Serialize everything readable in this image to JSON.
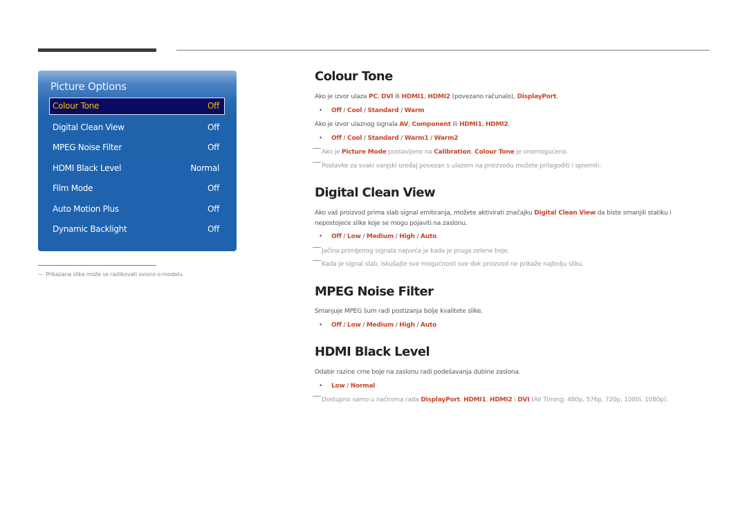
{
  "menu": {
    "title": "Picture Options",
    "items": [
      {
        "label": "Colour Tone",
        "value": "Off",
        "selected": true
      },
      {
        "label": "Digital Clean View",
        "value": "Off"
      },
      {
        "label": "MPEG Noise Filter",
        "value": "Off"
      },
      {
        "label": "HDMI Black Level",
        "value": "Normal"
      },
      {
        "label": "Film Mode",
        "value": "Off"
      },
      {
        "label": "Auto Motion Plus",
        "value": "Off"
      },
      {
        "label": "Dynamic Backlight",
        "value": "Off"
      }
    ]
  },
  "footnote": "Prikazana slika može se razlikovati ovisno o modelu.",
  "footnote_dash": "−",
  "sections": {
    "colour_tone": {
      "title": "Colour Tone",
      "p1": [
        "Ako je izvor ulaza ",
        "PC",
        ", ",
        "DVI",
        " ili ",
        "HDMI1",
        ", ",
        "HDMI2",
        " (povezano računalo), ",
        "DisplayPort",
        "."
      ],
      "opts1": [
        "Off",
        "Cool",
        "Standard",
        "Warm"
      ],
      "p2": [
        "Ako je izvor ulaznog signala ",
        "AV",
        ", ",
        "Component",
        " ili ",
        "HDMI1",
        ", ",
        "HDMI2",
        "."
      ],
      "opts2": [
        "Off",
        "Cool",
        "Standard",
        "Warm1",
        "Warm2"
      ],
      "note1": [
        "Ako je ",
        "Picture Mode",
        " postavljeno na ",
        "Calibration",
        ", ",
        "Colour Tone",
        " je onemogućeno."
      ],
      "note2": "Postavke za svaki vanjski uređaj povezan s ulazom na proizvodu možete prilagoditi i spremiti."
    },
    "digital_clean_view": {
      "title": "Digital Clean View",
      "p1": [
        "Ako vaš proizvod prima slab signal emitiranja, možete aktivirati značajku ",
        "Digital Clean View",
        " da biste smanjili statiku i nepostojeće slike koje se mogu pojaviti na zaslonu."
      ],
      "opts": [
        "Off",
        "Low",
        "Medium",
        "High",
        "Auto"
      ],
      "note1": "Jačina primljenog signala najveća je kada je pruga zelene boje.",
      "note2": "Kada je signal slab, iskušajte sve mogućnosti sve dok proizvod ne prikaže najbolju sliku."
    },
    "mpeg_noise_filter": {
      "title": "MPEG Noise Filter",
      "p1": "Smanjuje MPEG šum radi postizanja bolje kvalitete slike.",
      "opts": [
        "Off",
        "Low",
        "Medium",
        "High",
        "Auto"
      ]
    },
    "hdmi_black_level": {
      "title": "HDMI Black Level",
      "p1": "Odabir razine crne boje na zaslonu radi podešavanja dubine zaslona.",
      "opts": [
        "Low",
        "Normal"
      ],
      "note1": [
        "Dostupno samo u načinima rada ",
        "DisplayPort",
        ", ",
        "HDMI1",
        ", ",
        "HDMI2",
        " i ",
        "DVI",
        " (AV Timing: 480p, 576p, 720p, 1080i, 1080p)."
      ]
    }
  },
  "separator": " / ",
  "bullet": "•",
  "colors": {
    "accent": "#c6462a",
    "panel_blue": "#1f62ad",
    "selected_bg": "#0a0a60",
    "selected_text": "#f2c200"
  }
}
